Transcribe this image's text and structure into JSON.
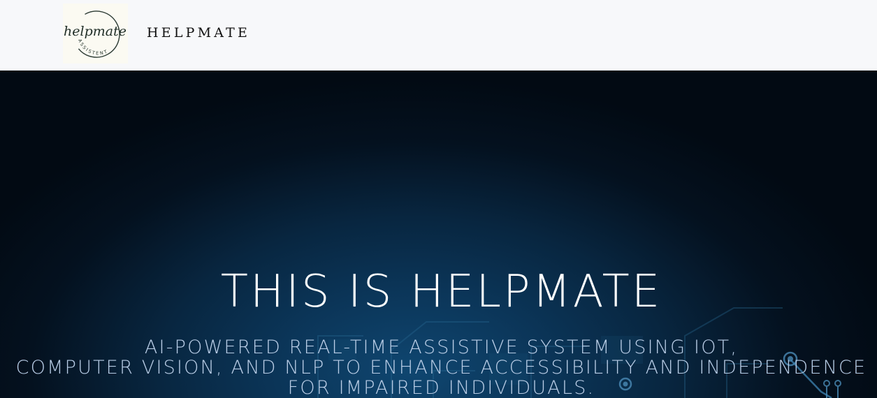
{
  "header": {
    "logo": {
      "script_text": "helpmate",
      "ring_text": "ASSISTENT"
    },
    "brand": "HELPMATE"
  },
  "hero": {
    "title": "THIS IS HELPMATE",
    "subtitle_lines": [
      "AI-POWERED REAL-TIME ASSISTIVE SYSTEM USING IOT,",
      "COMPUTER VISION, AND NLP TO ENHANCE ACCESSIBILITY AND INDEPENDENCE",
      "FOR IMPAIRED INDIVIDUALS."
    ]
  },
  "colors": {
    "header_bg": "#f7f8fa",
    "hero_bg_dark": "#020a13",
    "hero_bg_glow": "#0f4670",
    "title": "#ffffff",
    "subtitle": "#b9cde6"
  }
}
